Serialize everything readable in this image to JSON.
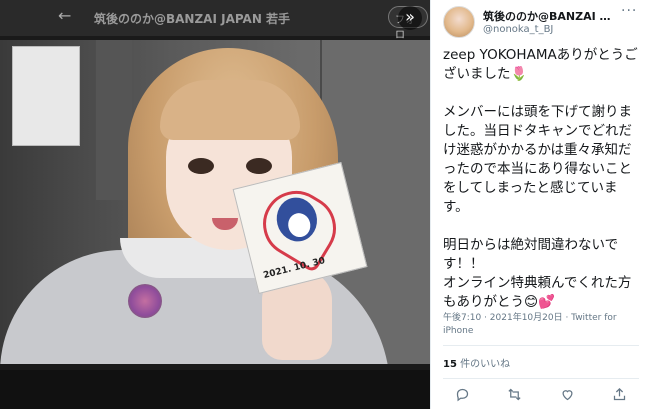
{
  "viewer": {
    "topbar_title": "筑後ののか@BANZAI JAPAN 若手",
    "follow_label": "フォロ",
    "collapse_glyph": "»",
    "back_glyph": "←"
  },
  "photo": {
    "card_date": "2021. 10. 30"
  },
  "tweet": {
    "author_name": "筑後ののか@BANZAI JAPA...",
    "author_handle": "@nonoka_t_BJ",
    "more_glyph": "···",
    "text": "zeep YOKOHAMAありがとうございました🌷\n\nメンバーには頭を下げて謝りました。当日ドタキャンでどれだけ迷惑がかかるかは重々承知だったので本当にあり得ないことをしてしまったと感じています。\n\n明日からは絶対間違わないです！！\nオンライン特典頼んでくれた方もありがとう😊💕",
    "timestamp_source": "午後7:10 · 2021年10月20日 · Twitter for iPhone",
    "likes_count": "15",
    "likes_label": "件のいいね"
  },
  "colors": {
    "text_primary": "#14171a",
    "text_secondary": "#657786",
    "divider": "#e6ecf0"
  },
  "icons": [
    "back-arrow-icon",
    "collapse-icon",
    "more-icon",
    "reply-icon",
    "retweet-icon",
    "like-icon",
    "share-icon"
  ]
}
